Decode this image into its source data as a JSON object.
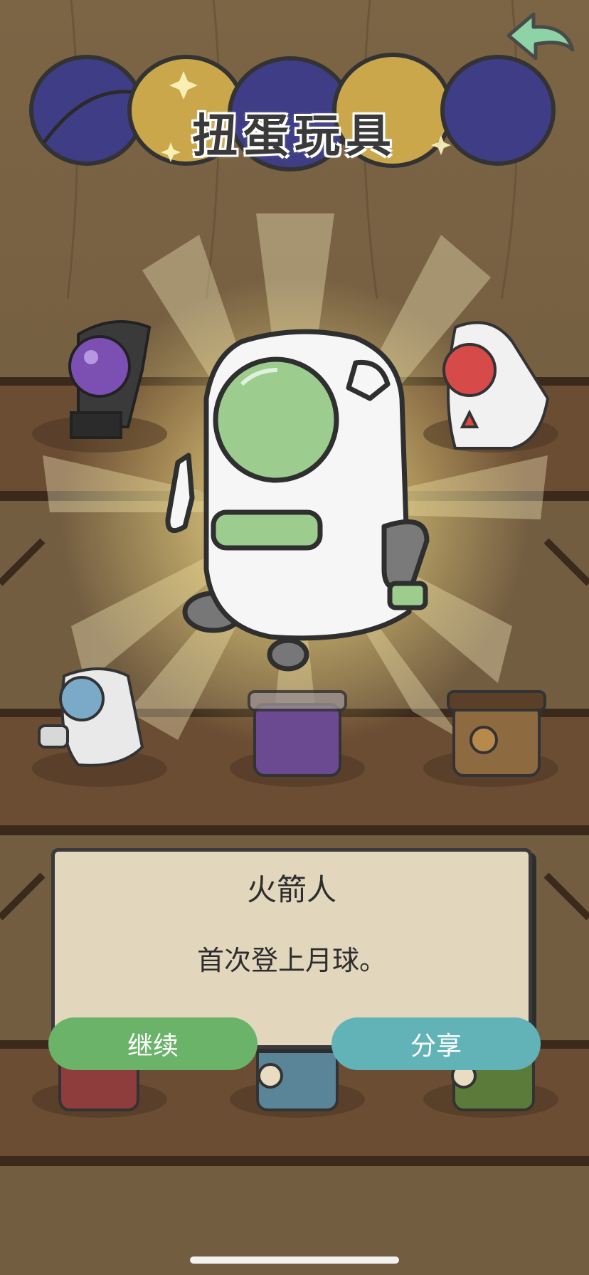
{
  "title": "扭蛋玩具",
  "dialog": {
    "name": "火箭人",
    "description": "首次登上月球。"
  },
  "buttons": {
    "continue_label": "继续",
    "share_label": "分享"
  },
  "icons": {
    "back": "back-arrow-icon"
  },
  "colors": {
    "continue_button": "#6cb36a",
    "share_button": "#62b3b8",
    "dialog_bg": "#e2d7bd",
    "back_arrow": "#8ed3a6"
  }
}
